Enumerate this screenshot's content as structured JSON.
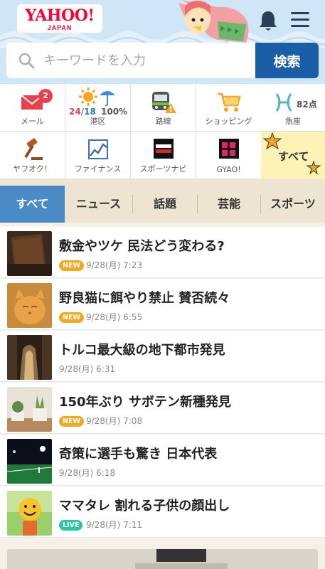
{
  "header": {
    "logo_text": "YAHOO!",
    "logo_sub": "JAPAN",
    "bell": "bell-icon",
    "menu": "hamburger-menu-icon"
  },
  "search": {
    "placeholder": "キーワードを入力",
    "value": "",
    "button_label": "検索"
  },
  "services": {
    "row1": [
      {
        "label": "メール",
        "icon": "mail-icon",
        "badge": "2"
      },
      {
        "label": "港区",
        "icon": "weather-sun-umbrella-icon",
        "temp_high": "24",
        "temp_sep": "/",
        "temp_low": "18",
        "rain": "100%"
      },
      {
        "label": "路線",
        "icon": "train-warning-icon"
      },
      {
        "label": "ショッピング",
        "icon": "shopping-cart-icon"
      },
      {
        "label": "魚座",
        "icon": "pisces-icon",
        "score": "82点"
      }
    ],
    "row2": [
      {
        "label": "ヤフオク！",
        "icon": "auction-gavel-icon"
      },
      {
        "label": "ファイナンス",
        "icon": "finance-chart-icon"
      },
      {
        "label": "スポーツナビ",
        "icon": "sportsnavi-logo-icon"
      },
      {
        "label": "GYAO!",
        "icon": "gyao-logo-icon"
      },
      {
        "label": "すべて",
        "icon": "stars-icon"
      }
    ]
  },
  "tabs": [
    {
      "label": "すべて",
      "active": true
    },
    {
      "label": "ニュース"
    },
    {
      "label": "話題"
    },
    {
      "label": "芸能"
    },
    {
      "label": "スポーツ"
    }
  ],
  "news": [
    {
      "title": "敷金やツケ 民法どう変わる?",
      "tag": "NEW",
      "date": "9/28(月) 7:23",
      "thumb": "book-photo"
    },
    {
      "title": "野良猫に餌やり禁止 賛否続々",
      "tag": "NEW",
      "date": "9/28(月) 6:55",
      "thumb": "cat-photo"
    },
    {
      "title": "トルコ最大級の地下都市発見",
      "tag": "",
      "date": "9/28(月) 6:31",
      "thumb": "tunnel-photo"
    },
    {
      "title": "150年ぶり サボテン新種発見",
      "tag": "NEW",
      "date": "9/28(月) 7:08",
      "thumb": "cactus-photo"
    },
    {
      "title": "奇策に選手も驚き 日本代表",
      "tag": "",
      "date": "9/28(月) 6:18",
      "thumb": "stadium-photo"
    },
    {
      "title": "ママタレ 割れる子供の顔出し",
      "tag": "LIVE",
      "date": "9/28(月) 7:11",
      "thumb": "smiley-mask-photo"
    }
  ],
  "colors": {
    "search_button": "#1a5ea8",
    "active_tab": "#4a8ac6",
    "new_tag": "#f2a81f",
    "live_tag": "#2ec5a6",
    "badge": "#e8414b"
  }
}
